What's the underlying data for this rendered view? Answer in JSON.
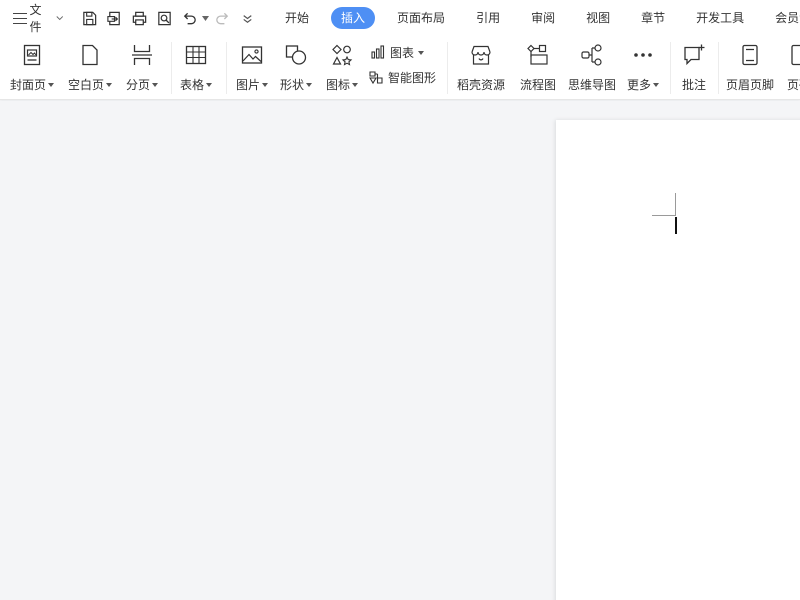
{
  "app": {
    "file_menu_label": "文件"
  },
  "quick_access": [
    {
      "name": "save-icon"
    },
    {
      "name": "export-pdf-icon"
    },
    {
      "name": "print-icon"
    },
    {
      "name": "print-preview-icon"
    },
    {
      "name": "undo-icon"
    },
    {
      "name": "redo-icon"
    },
    {
      "name": "customize-quick-access-icon"
    }
  ],
  "tabs": [
    {
      "label": "开始",
      "active": false
    },
    {
      "label": "插入",
      "active": true
    },
    {
      "label": "页面布局",
      "active": false
    },
    {
      "label": "引用",
      "active": false
    },
    {
      "label": "审阅",
      "active": false
    },
    {
      "label": "视图",
      "active": false
    },
    {
      "label": "章节",
      "active": false
    },
    {
      "label": "开发工具",
      "active": false
    },
    {
      "label": "会员专享",
      "active": false
    }
  ],
  "ribbon": {
    "cover_page": "封面页",
    "blank_page": "空白页",
    "page_break": "分页",
    "table": "表格",
    "picture": "图片",
    "shape": "形状",
    "icon": "图标",
    "chart": "图表",
    "smart_art": "智能图形",
    "docer_resources": "稻壳资源",
    "flowchart": "流程图",
    "mind_map": "思维导图",
    "more": "更多",
    "comment": "批注",
    "header_footer": "页眉页脚",
    "page_number": "页码"
  },
  "colors": {
    "accent": "#4e8ff4",
    "workspace_bg": "#f4f5f7"
  }
}
